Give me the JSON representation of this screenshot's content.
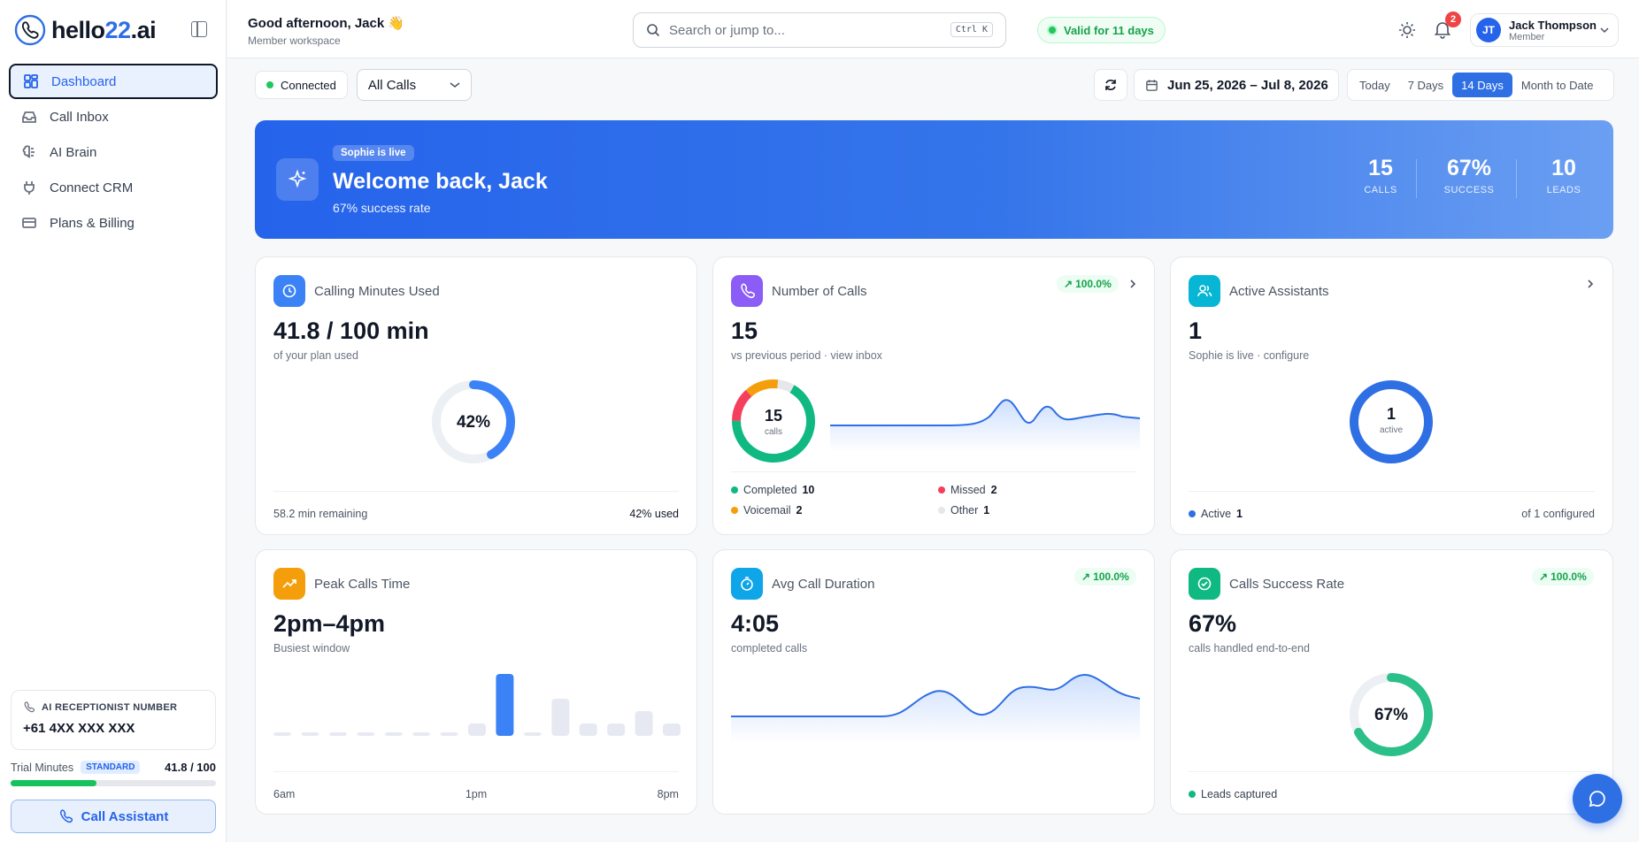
{
  "brand": {
    "name_a": "hello",
    "name_b": "22",
    "name_c": ".ai"
  },
  "nav": [
    {
      "label": "Dashboard",
      "icon": "grid-icon",
      "active": true
    },
    {
      "label": "Call Inbox",
      "icon": "inbox-icon"
    },
    {
      "label": "AI Brain",
      "icon": "brain-icon"
    },
    {
      "label": "Connect CRM",
      "icon": "plug-icon"
    },
    {
      "label": "Plans & Billing",
      "icon": "card-icon"
    }
  ],
  "receptionist": {
    "label": "AI RECEPTIONIST NUMBER",
    "number": "+61 4XX XXX XXX"
  },
  "trial": {
    "label": "Trial Minutes",
    "plan": "STANDARD",
    "value": "41.8 / 100",
    "fraction": 0.418
  },
  "call_button": "Call Assistant",
  "header": {
    "greeting": "Good afternoon, Jack 👋",
    "workspace": "Member workspace",
    "search_placeholder": "Search or jump to...",
    "shortcut": "Ctrl K",
    "validity": "Valid for 11 days",
    "notifications": "2",
    "user_name": "Jack Thompson",
    "user_role": "Member",
    "user_initials": "JT"
  },
  "filters": {
    "status": "Connected",
    "call_filter": "All Calls",
    "date_range": "Jun 25, 2026 – Jul 8, 2026",
    "periods": [
      "Today",
      "7 Days",
      "14 Days",
      "Month to Date"
    ],
    "active_period": "14 Days"
  },
  "hero": {
    "pill": "Sophie is live",
    "title": "Welcome back, Jack",
    "subtitle": "67% success rate",
    "stats": [
      {
        "value": "15",
        "label": "CALLS"
      },
      {
        "value": "67%",
        "label": "SUCCESS"
      },
      {
        "value": "10",
        "label": "LEADS"
      }
    ]
  },
  "cards": {
    "minutes": {
      "title": "Calling Minutes Used",
      "big": "41.8 / 100 min",
      "sub": "of your plan used",
      "donut": "42%",
      "fraction": 0.42,
      "foot_left": "58.2 min remaining",
      "foot_right": "42% used"
    },
    "calls": {
      "title": "Number of Calls",
      "pill": "100.0%",
      "big": "15",
      "sub": "vs previous period · view inbox",
      "donut_value": "15",
      "donut_label": "calls",
      "legend": [
        {
          "label": "Completed",
          "value": "10",
          "color": "#10b981"
        },
        {
          "label": "Missed",
          "value": "2",
          "color": "#f43f5e"
        },
        {
          "label": "Voicemail",
          "value": "2",
          "color": "#f59e0b"
        },
        {
          "label": "Other",
          "value": "1",
          "color": "#e5e7eb"
        }
      ]
    },
    "assistants": {
      "title": "Active Assistants",
      "big": "1",
      "sub": "Sophie is live · configure",
      "donut_value": "1",
      "donut_label": "active",
      "foot_label": "Active",
      "foot_value": "1",
      "foot_right": "of 1 configured"
    },
    "peak": {
      "title": "Peak Calls Time",
      "big": "2pm–4pm",
      "sub": "Busiest window",
      "axis": [
        "6am",
        "1pm",
        "8pm"
      ],
      "bars": [
        0.04,
        0.04,
        0.04,
        0.04,
        0.04,
        0.04,
        0.04,
        0.2,
        1.0,
        0.04,
        0.6,
        0.2,
        0.2,
        0.4,
        0.2
      ]
    },
    "duration": {
      "title": "Avg Call Duration",
      "pill": "100.0%",
      "big": "4:05",
      "sub": "completed calls"
    },
    "success": {
      "title": "Calls Success Rate",
      "pill": "100.0%",
      "big": "67%",
      "sub": "calls handled end-to-end",
      "donut": "67%",
      "fraction": 0.67,
      "foot_left": "Leads captured"
    }
  }
}
